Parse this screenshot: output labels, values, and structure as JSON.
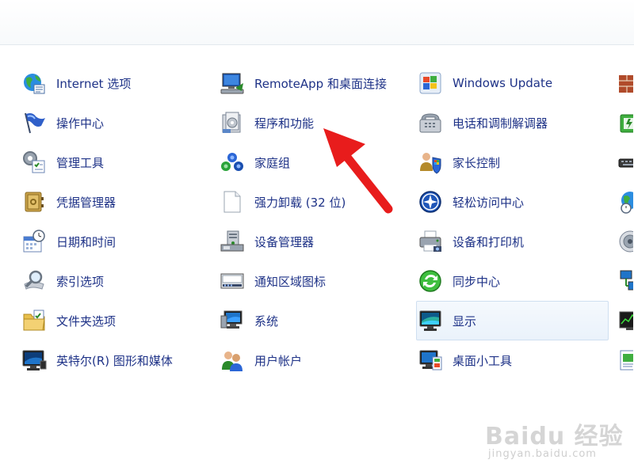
{
  "columns": [
    {
      "items": [
        {
          "label": "Internet 选项",
          "icon": "globe-settings-icon"
        },
        {
          "label": "操作中心",
          "icon": "flag-icon"
        },
        {
          "label": "管理工具",
          "icon": "admin-tools-icon"
        },
        {
          "label": "凭据管理器",
          "icon": "vault-icon"
        },
        {
          "label": "日期和时间",
          "icon": "calendar-clock-icon"
        },
        {
          "label": "索引选项",
          "icon": "magnifier-icon"
        },
        {
          "label": "文件夹选项",
          "icon": "folder-icon"
        },
        {
          "label": "英特尔(R) 图形和媒体",
          "icon": "monitor-icon"
        }
      ]
    },
    {
      "items": [
        {
          "label": "RemoteApp 和桌面连接",
          "icon": "remote-desktop-icon"
        },
        {
          "label": "程序和功能",
          "icon": "programs-icon"
        },
        {
          "label": "家庭组",
          "icon": "homegroup-icon"
        },
        {
          "label": "强力卸载 (32 位)",
          "icon": "blank-document-icon"
        },
        {
          "label": "设备管理器",
          "icon": "device-manager-icon"
        },
        {
          "label": "通知区域图标",
          "icon": "notification-area-icon"
        },
        {
          "label": "系统",
          "icon": "system-icon"
        },
        {
          "label": "用户帐户",
          "icon": "users-icon"
        }
      ]
    },
    {
      "items": [
        {
          "label": "Windows Update",
          "icon": "windows-update-icon"
        },
        {
          "label": "电话和调制解调器",
          "icon": "telephone-icon"
        },
        {
          "label": "家长控制",
          "icon": "parental-control-icon"
        },
        {
          "label": "轻松访问中心",
          "icon": "ease-of-access-icon"
        },
        {
          "label": "设备和打印机",
          "icon": "printer-icon"
        },
        {
          "label": "同步中心",
          "icon": "sync-icon"
        },
        {
          "label": "显示",
          "icon": "display-icon"
        },
        {
          "label": "桌面小工具",
          "icon": "gadgets-icon"
        }
      ]
    }
  ],
  "fourth_column_icons": [
    "firewall-icon",
    "power-icon",
    "keyboard-icon",
    "region-globe-icon",
    "speaker-icon",
    "network-icon",
    "performance-icon",
    "taskbar-icon"
  ],
  "hovered_item": "显示",
  "colors": {
    "label": "#1e3287",
    "arrow": "#e81c1c",
    "hover_bg": "#eaf2fb",
    "hover_border": "#cfdff0"
  },
  "watermark": {
    "brand": "Baidu 经验",
    "url": "jingyan.baidu.com"
  }
}
